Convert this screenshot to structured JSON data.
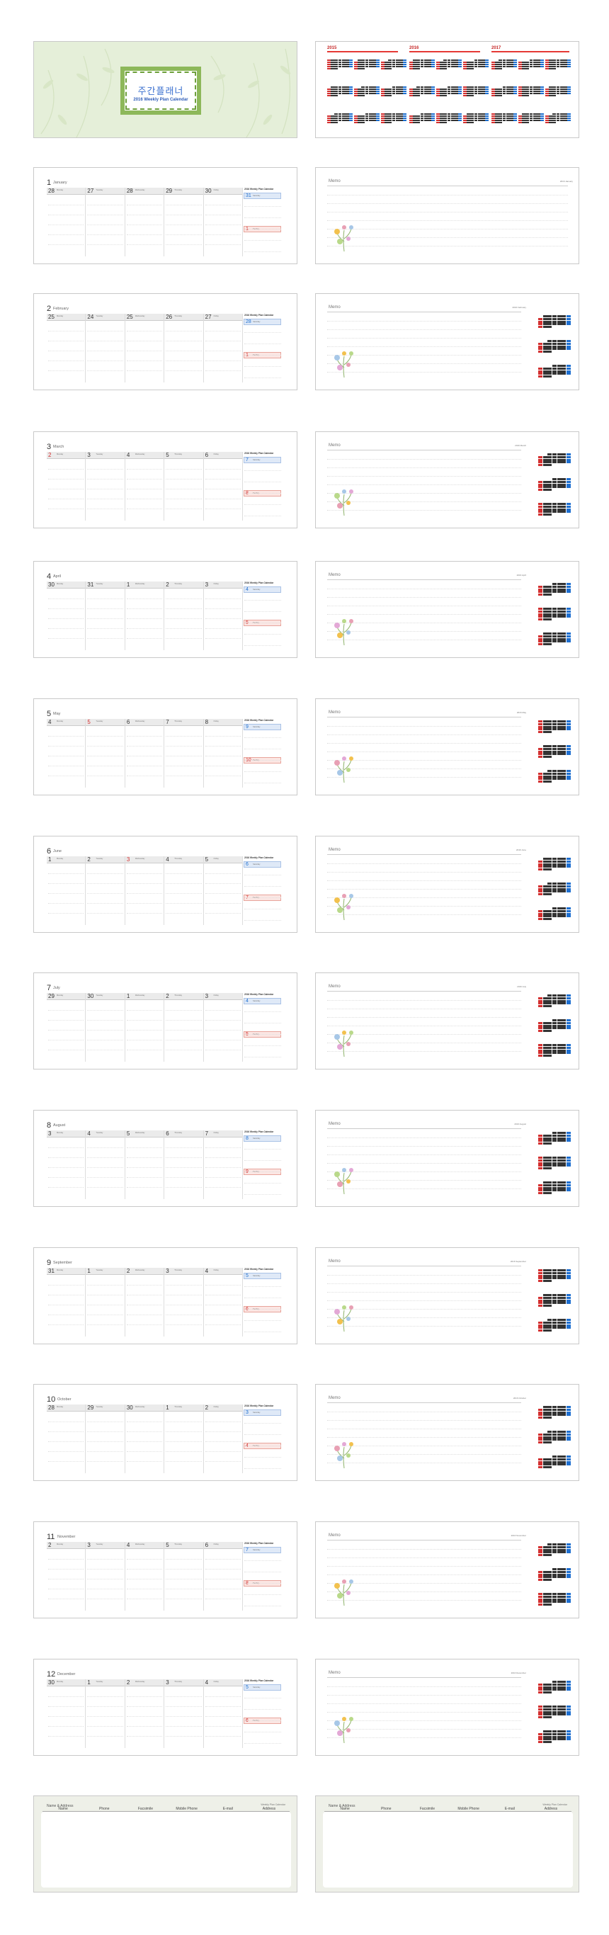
{
  "cover": {
    "title": "주간플래너",
    "subtitle": "2016 Weekly Plan Calendar"
  },
  "year_overview": {
    "years": [
      "2015",
      "2016",
      "2017"
    ]
  },
  "weekly_header": {
    "brand": "2016 Weekly Plan Calendar"
  },
  "months": [
    {
      "num": "1",
      "name": "January",
      "days": [
        "28",
        "27",
        "28",
        "29",
        "30",
        "31",
        "1"
      ],
      "memo_header": "2016 January"
    },
    {
      "num": "2",
      "name": "February",
      "days": [
        "25",
        "24",
        "25",
        "26",
        "27",
        "28",
        "1"
      ],
      "memo_header": "2016 February"
    },
    {
      "num": "3",
      "name": "March",
      "days": [
        "2",
        "3",
        "4",
        "5",
        "6",
        "7",
        "8"
      ],
      "memo_header": "2016 March"
    },
    {
      "num": "4",
      "name": "April",
      "days": [
        "30",
        "31",
        "1",
        "2",
        "3",
        "4",
        "5"
      ],
      "memo_header": "2016 April"
    },
    {
      "num": "5",
      "name": "May",
      "days": [
        "4",
        "5",
        "6",
        "7",
        "8",
        "9",
        "10"
      ],
      "memo_header": "2016 May"
    },
    {
      "num": "6",
      "name": "June",
      "days": [
        "1",
        "2",
        "3",
        "4",
        "5",
        "6",
        "7"
      ],
      "memo_header": "2016 June"
    },
    {
      "num": "7",
      "name": "July",
      "days": [
        "29",
        "30",
        "1",
        "2",
        "3",
        "4",
        "5"
      ],
      "memo_header": "2016 July"
    },
    {
      "num": "8",
      "name": "August",
      "days": [
        "3",
        "4",
        "5",
        "6",
        "7",
        "8",
        "9"
      ],
      "memo_header": "2016 August"
    },
    {
      "num": "9",
      "name": "September",
      "days": [
        "31",
        "1",
        "2",
        "3",
        "4",
        "5",
        "6"
      ],
      "memo_header": "2016 September"
    },
    {
      "num": "10",
      "name": "October",
      "days": [
        "28",
        "29",
        "30",
        "1",
        "2",
        "3",
        "4"
      ],
      "memo_header": "2016 October"
    },
    {
      "num": "11",
      "name": "November",
      "days": [
        "2",
        "3",
        "4",
        "5",
        "6",
        "7",
        "8"
      ],
      "memo_header": "2016 November"
    },
    {
      "num": "12",
      "name": "December",
      "days": [
        "30",
        "1",
        "2",
        "3",
        "4",
        "5",
        "6"
      ],
      "memo_header": "2016 December"
    }
  ],
  "weekday_labels": [
    "Monday",
    "Tuesday",
    "Wednesday",
    "Thursday",
    "Friday",
    "Saturday",
    "Sunday"
  ],
  "memo_label": "Memo",
  "address_book": {
    "title": "Name & Address",
    "brand": "Weekly Plan Calendar",
    "columns": [
      "Name",
      "Phone",
      "Facsimile",
      "Mobile Phone",
      "E-mail",
      "Address"
    ]
  },
  "colors": {
    "accent_blue": "#1e6fd0",
    "accent_red": "#d32f2f",
    "cover_green": "#8db85a"
  }
}
